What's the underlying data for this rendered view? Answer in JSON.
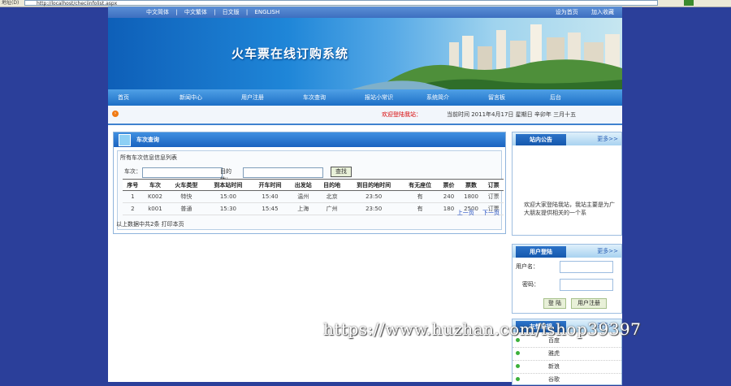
{
  "browser": {
    "address_label": "地址(D)",
    "url": "http://localhost/checiinfolist.aspx"
  },
  "topnav": {
    "langs": [
      "中文简体",
      "|",
      "中文繁体",
      "|",
      "日文版",
      "|",
      "ENGLISH"
    ],
    "home_link": "设为首页",
    "fav_link": "加入收藏"
  },
  "banner": {
    "title": "火车票在线订购系统"
  },
  "menu": [
    "首页",
    "新闻中心",
    "用户注册",
    "车次查询",
    "报站小常识",
    "系统简介",
    "留言板",
    "后台"
  ],
  "status": {
    "welcome": "欢迎登陆我站：",
    "time": "当前时间  2011年4月17日 星期日 辛卯年 三月十五"
  },
  "query_panel": {
    "title": "车次查询",
    "caption": "所有车次信息信息列表",
    "train_label": "车次：",
    "dest_label": "目的地：",
    "search_button": "查找",
    "columns": [
      "序号",
      "车次",
      "火车类型",
      "到本站时间",
      "开车时间",
      "出发站",
      "目的地",
      "到目的地时间",
      "有无座位",
      "票价",
      "票数",
      "订票"
    ],
    "rows": [
      [
        "1",
        "K002",
        "特快",
        "15:00",
        "15:40",
        "温州",
        "北京",
        "23:50",
        "有",
        "240",
        "1800",
        "订票"
      ],
      [
        "2",
        "k001",
        "普通",
        "15:30",
        "15:45",
        "上海",
        "广州",
        "23:50",
        "有",
        "180",
        "2500",
        "订票"
      ]
    ],
    "prev_page": "上一页",
    "next_page": "下一页",
    "footer": "以上数据中共2条  打印本页"
  },
  "notice_box": {
    "title": "站内公告",
    "more": "更多>>",
    "text": "欢迎大家登陆我站，我站主要是为广大朋友提供相关的一个系"
  },
  "login_box": {
    "title": "用户登陆",
    "more": "更多>>",
    "user_label": "用户名：",
    "pass_label": "密码：",
    "login_button": "登 陆",
    "register_button": "用户注册"
  },
  "links_box": {
    "title": "友情链接",
    "more": "更多>>",
    "items": [
      "百度",
      "雅虎",
      "新浪",
      "谷歌"
    ]
  },
  "watermark": "https://www.huzhan.com/ishop39397"
}
